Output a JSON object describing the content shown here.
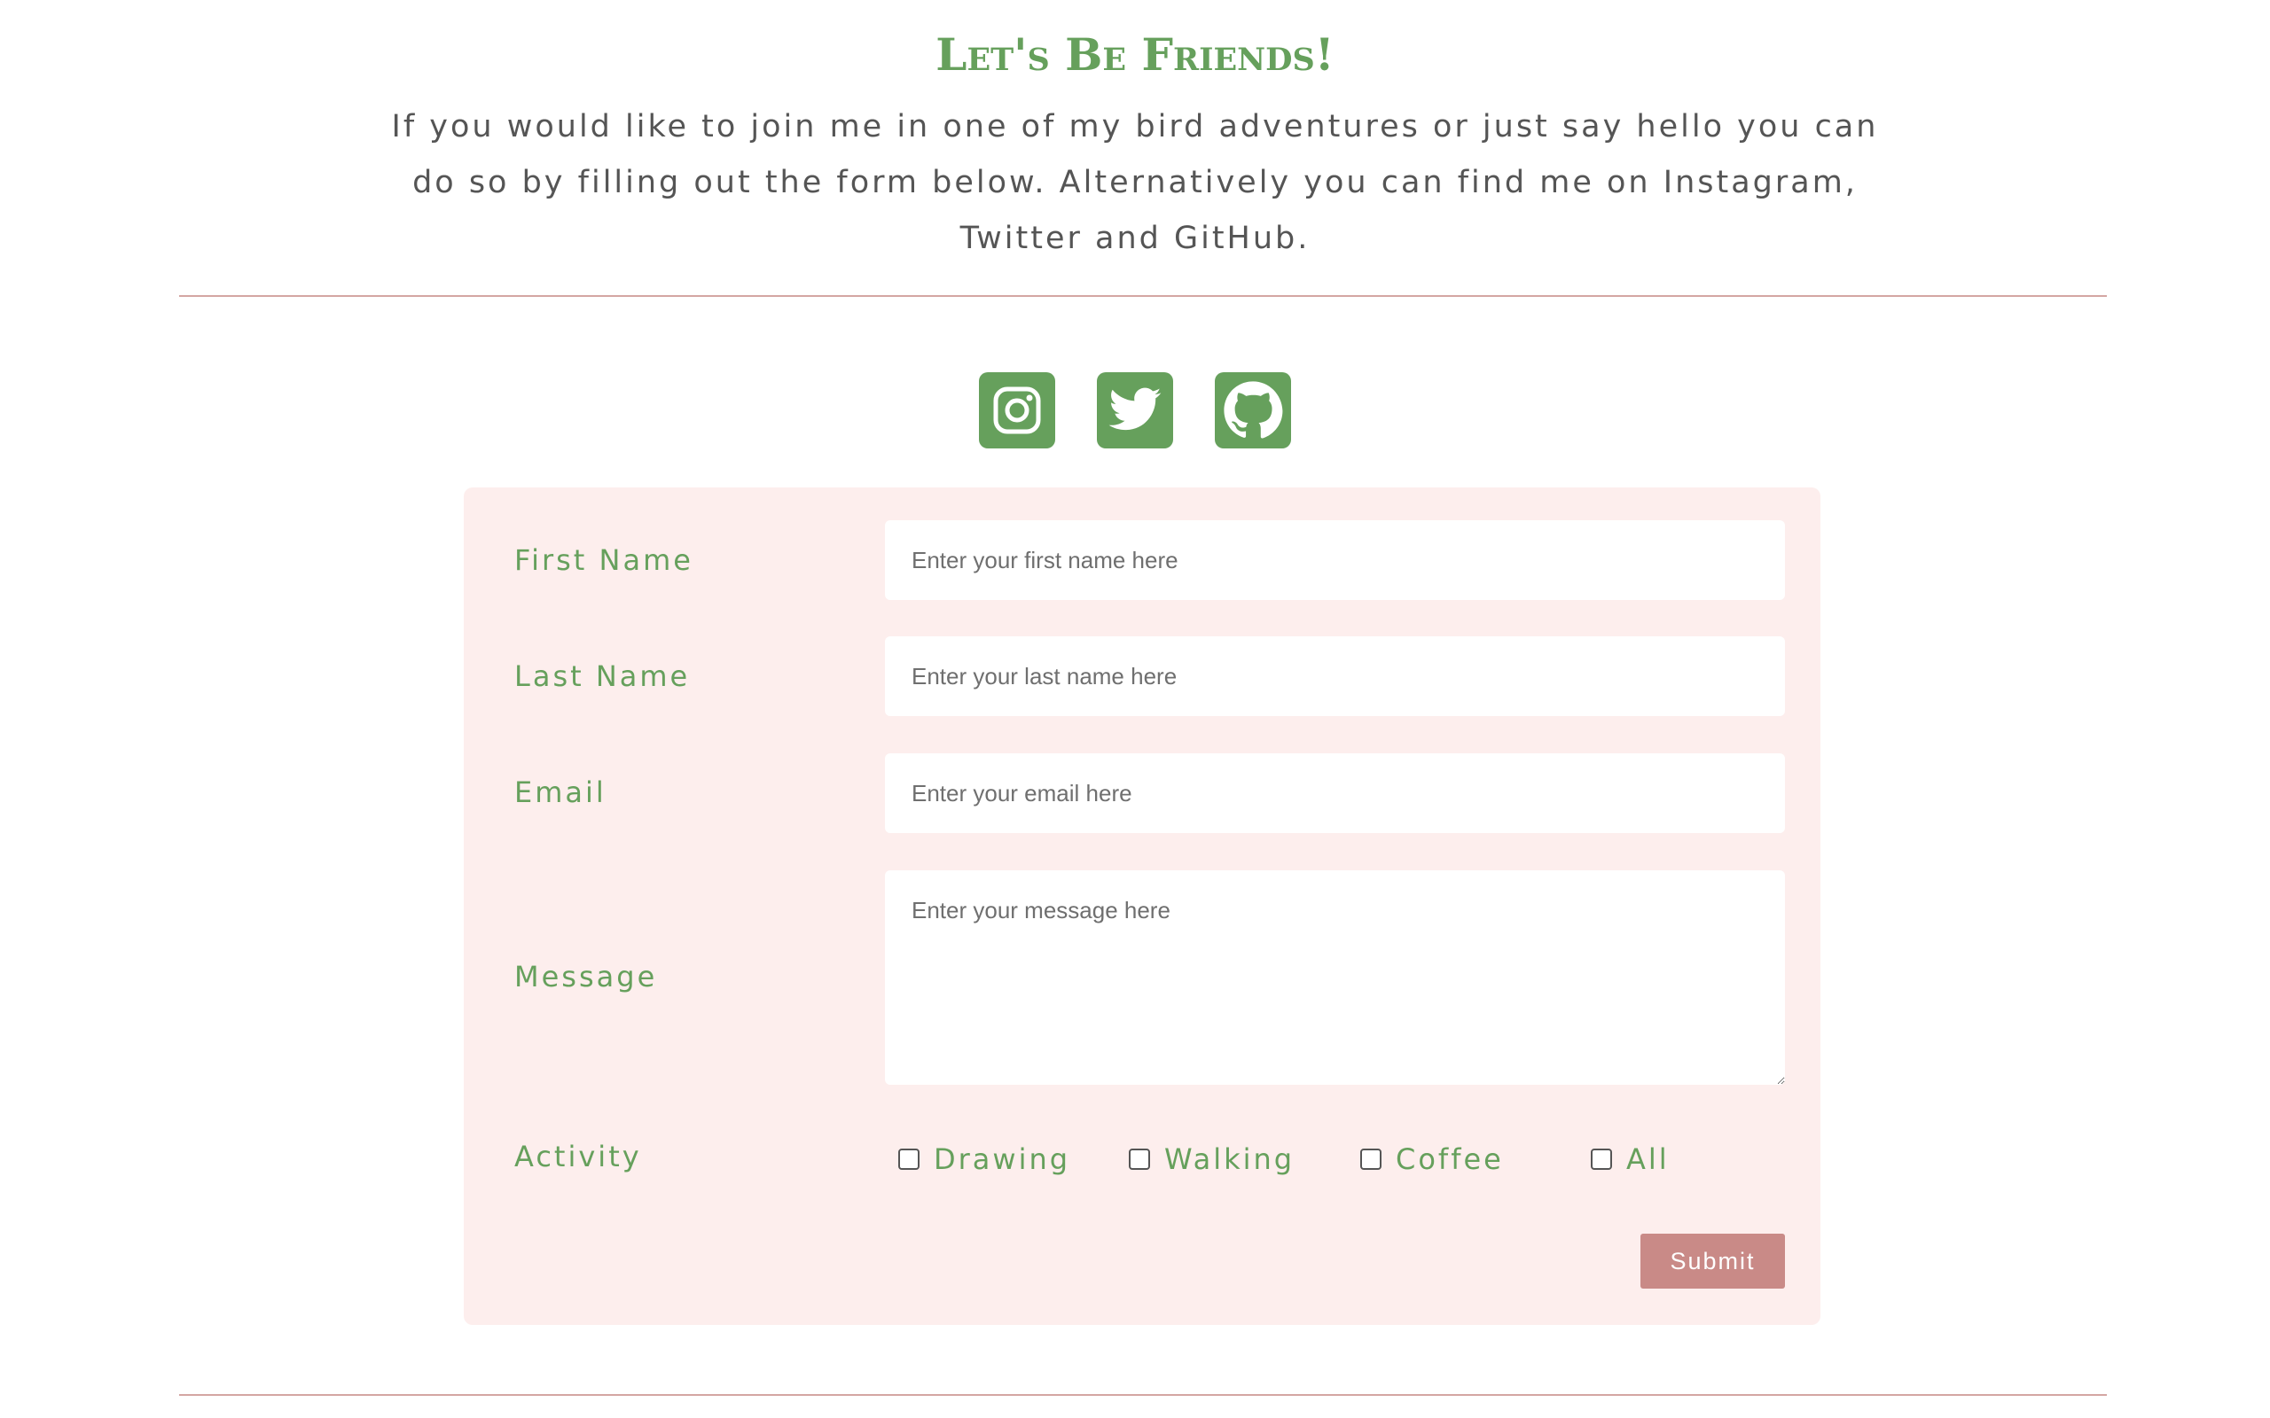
{
  "header": {
    "title": "Let's Be Friends!",
    "intro": "If you would like to join me in one of my bird adventures or just say hello you can do so by filling out the form below. Alternatively you can find me on Instagram, Twitter and GitHub."
  },
  "socials": [
    {
      "name": "Instagram",
      "icon": "instagram-icon"
    },
    {
      "name": "Twitter",
      "icon": "twitter-icon"
    },
    {
      "name": "GitHub",
      "icon": "github-icon"
    }
  ],
  "form": {
    "first_name": {
      "label": "First Name",
      "placeholder": "Enter your first name here",
      "value": ""
    },
    "last_name": {
      "label": "Last Name",
      "placeholder": "Enter your last name here",
      "value": ""
    },
    "email": {
      "label": "Email",
      "placeholder": "Enter your email here",
      "value": ""
    },
    "message": {
      "label": "Message",
      "placeholder": "Enter your message here",
      "value": ""
    },
    "activity": {
      "label": "Activity",
      "options": [
        {
          "label": "Drawing",
          "checked": false
        },
        {
          "label": "Walking",
          "checked": false
        },
        {
          "label": "Coffee",
          "checked": false
        },
        {
          "label": "All",
          "checked": false
        }
      ]
    },
    "submit_label": "Submit"
  },
  "colors": {
    "accent_green": "#66a05c",
    "divider_pink": "#d4a6a3",
    "form_background": "#fdeeed",
    "submit_button": "#c98a87",
    "body_text": "#555555"
  }
}
